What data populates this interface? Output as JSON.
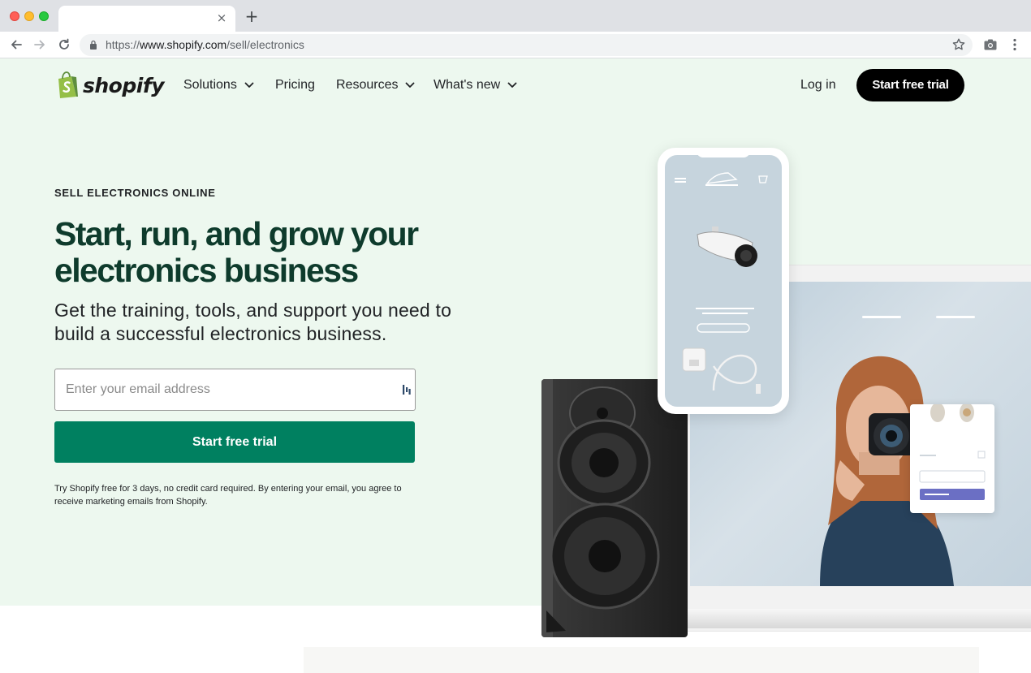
{
  "browser": {
    "tab": {
      "close_glyph": "×"
    },
    "new_tab_glyph": "+",
    "url_scheme": "https://",
    "url_host": "www.shopify.com",
    "url_path": "/sell/electronics"
  },
  "header": {
    "logo_text": "shopify",
    "nav": [
      {
        "label": "Solutions",
        "has_dropdown": true
      },
      {
        "label": "Pricing",
        "has_dropdown": false
      },
      {
        "label": "Resources",
        "has_dropdown": true
      },
      {
        "label": "What's new",
        "has_dropdown": true
      }
    ],
    "login_label": "Log in",
    "cta_label": "Start free trial"
  },
  "hero": {
    "eyebrow": "SELL ELECTRONICS ONLINE",
    "headline": "Start, run, and grow your electronics business",
    "subhead": "Get the training, tools, and support you need to build a successful electronics business.",
    "email_placeholder": "Enter your email address",
    "cta_label": "Start free trial",
    "fineprint": "Try Shopify free for 3 days, no credit card required. By entering your email, you agree to receive marketing emails from Shopify."
  },
  "colors": {
    "brand_green": "#008060",
    "hero_bg": "#edf8ef",
    "headline": "#0e3b2c",
    "header_cta_bg": "#000000"
  },
  "icons": {
    "back": "back-arrow-icon",
    "forward": "forward-arrow-icon",
    "reload": "reload-icon",
    "lock": "lock-icon",
    "bookmark": "star-icon",
    "camera": "camera-icon",
    "menu": "kebab-menu-icon",
    "dropdown": "chevron-down-icon",
    "password_manager": "password-manager-icon"
  }
}
